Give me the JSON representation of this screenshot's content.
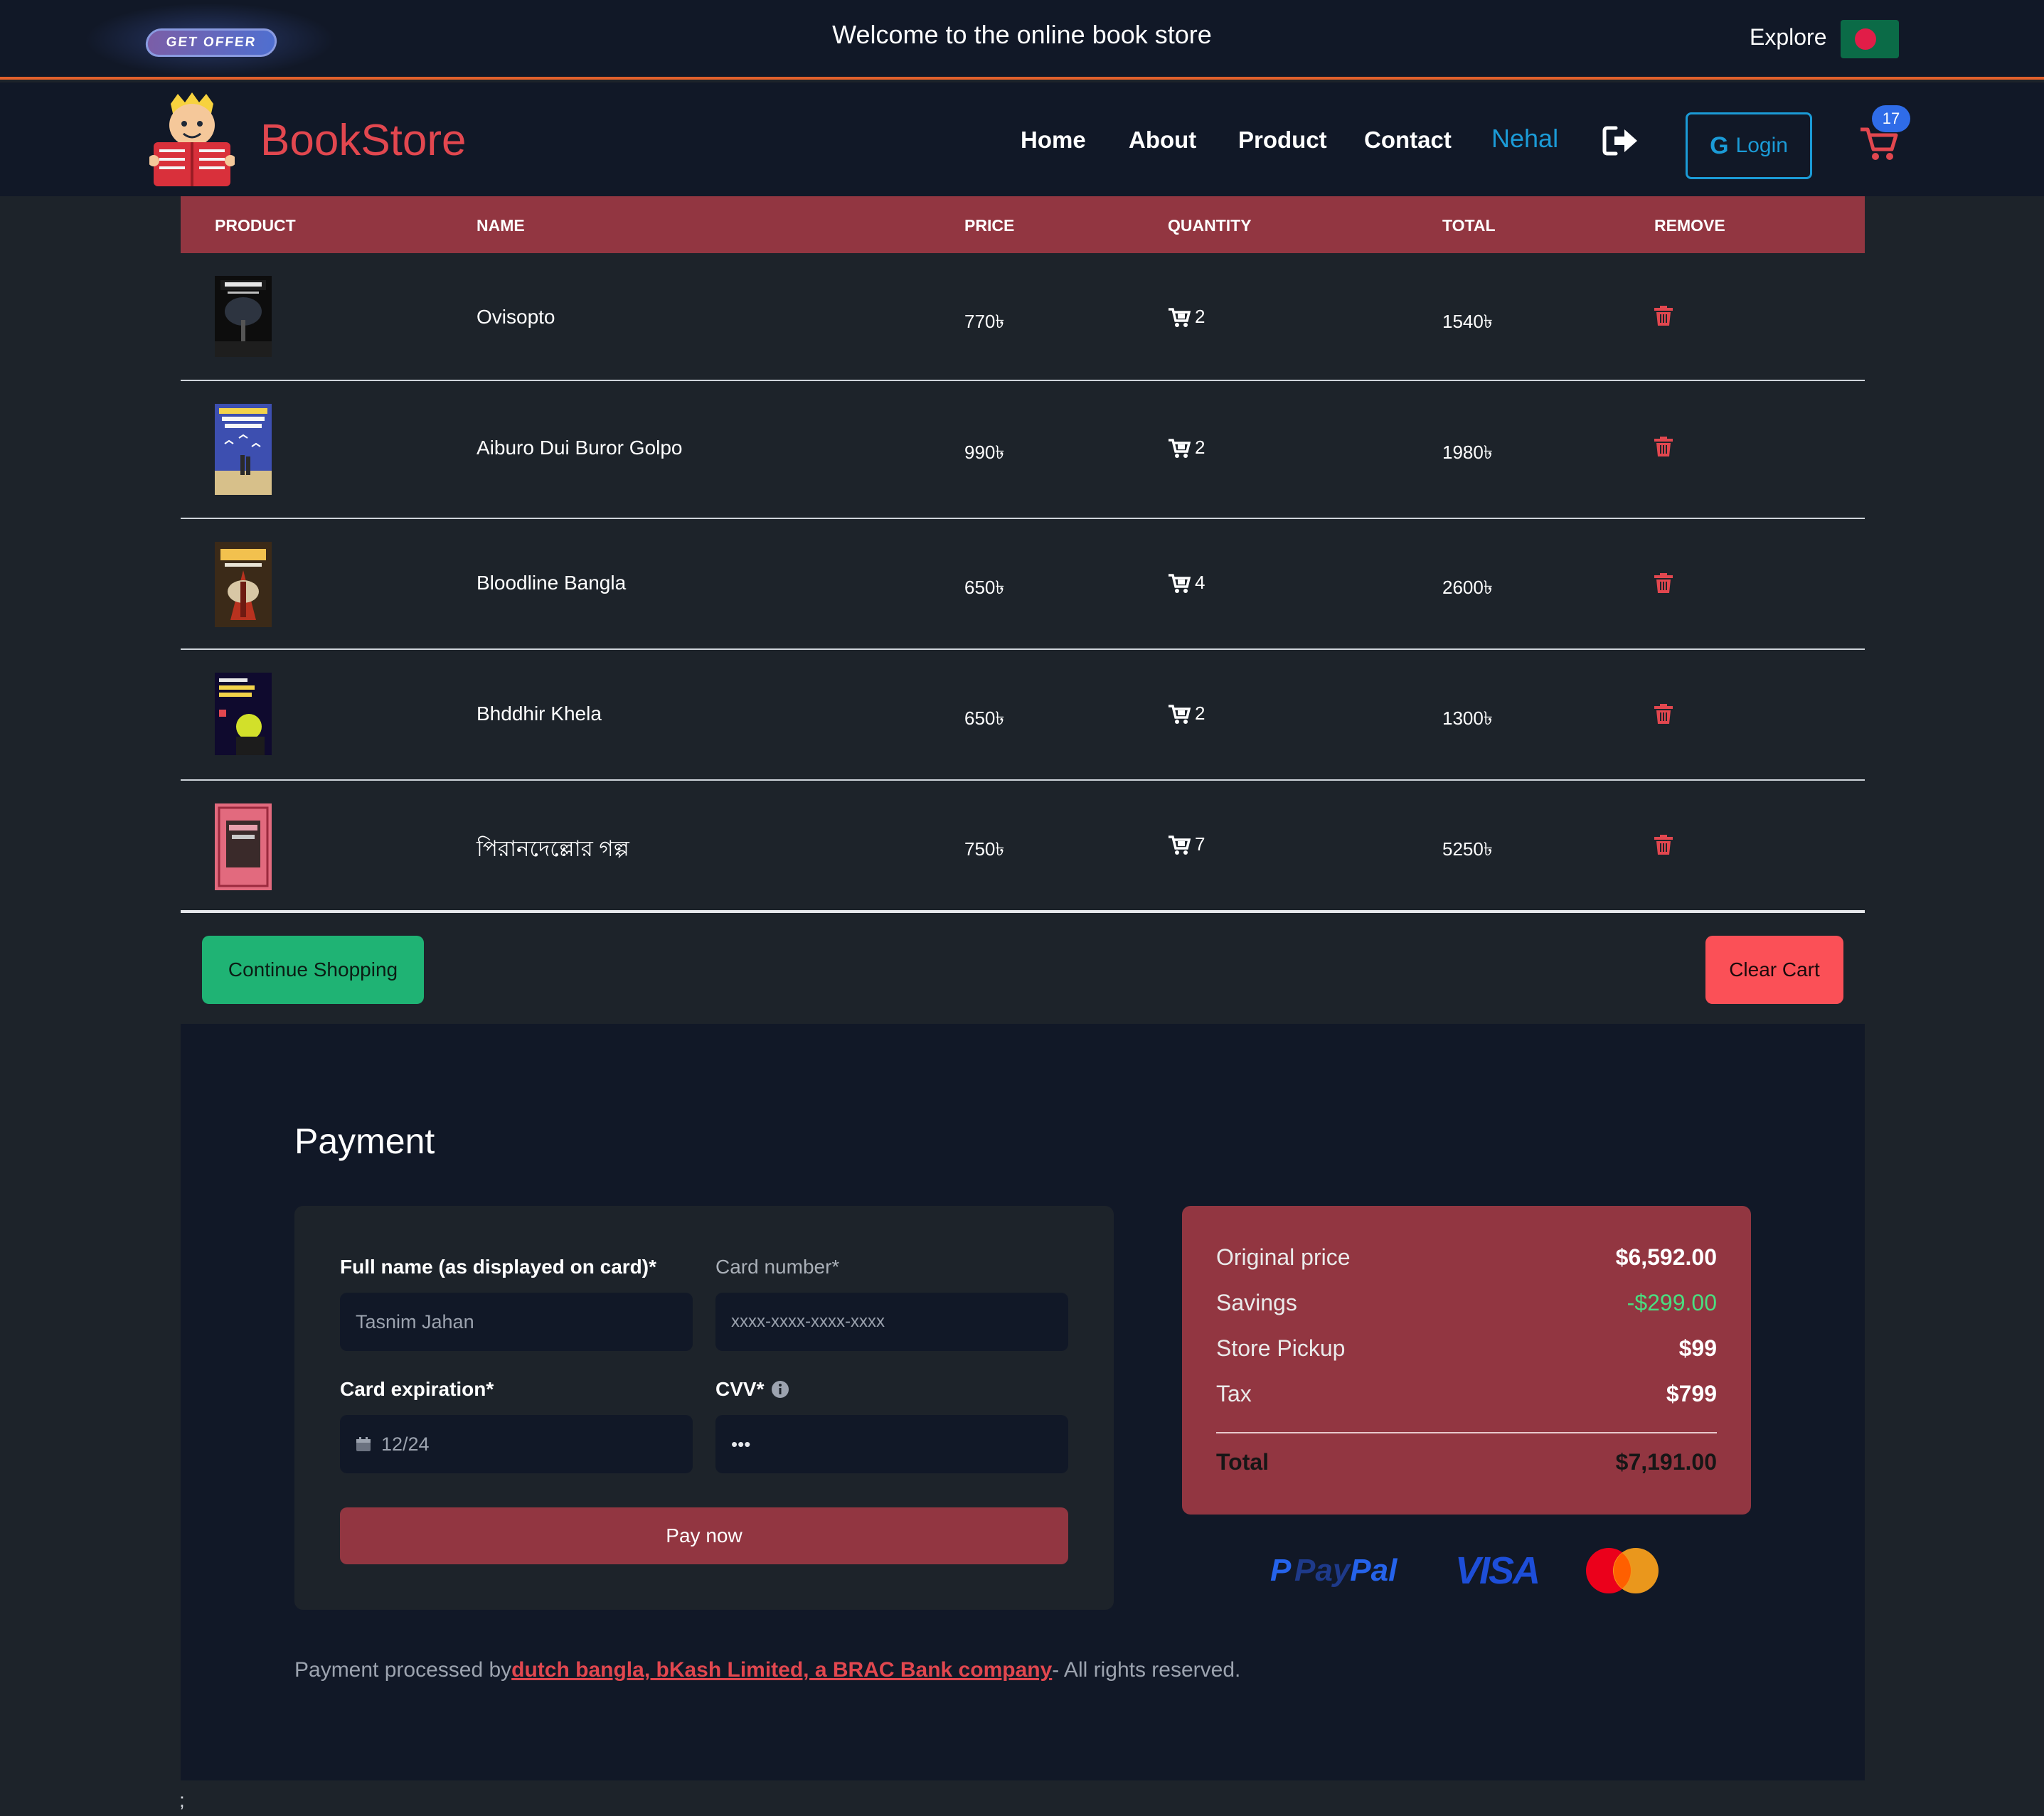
{
  "topbar": {
    "offer_label": "GET OFFER",
    "welcome": "Welcome to the online book store",
    "explore": "Explore"
  },
  "navbar": {
    "brand": "BookStore",
    "links": [
      "Home",
      "About",
      "Product",
      "Contact"
    ],
    "user": "Nehal",
    "login_label": "Login",
    "login_icon_letter": "G",
    "cart_count": "17"
  },
  "cart": {
    "headers": [
      "PRODUCT",
      "NAME",
      "PRICE",
      "QUANTITY",
      "TOTAL",
      "REMOVE"
    ],
    "rows": [
      {
        "name": "Ovisopto",
        "price": "770৳",
        "qty": "2",
        "total": "1540৳"
      },
      {
        "name": "Aiburo Dui Buror Golpo",
        "price": "990৳",
        "qty": "2",
        "total": "1980৳"
      },
      {
        "name": "Bloodline Bangla",
        "price": "650৳",
        "qty": "4",
        "total": "2600৳"
      },
      {
        "name": "Bhddhir Khela",
        "price": "650৳",
        "qty": "2",
        "total": "1300৳"
      },
      {
        "name": "পিরানদেল্লোর গল্প",
        "price": "750৳",
        "qty": "7",
        "total": "5250৳"
      }
    ],
    "continue_label": "Continue Shopping",
    "clear_label": "Clear Cart"
  },
  "payment": {
    "title": "Payment",
    "full_name_label": "Full name (as displayed on card)*",
    "full_name_value": "Tasnim Jahan",
    "card_number_label": "Card number*",
    "card_number_placeholder": "xxxx-xxxx-xxxx-xxxx",
    "expiration_label": "Card expiration*",
    "expiration_value": "12/24",
    "cvv_label": "CVV*",
    "cvv_value": "•••",
    "pay_label": "Pay now"
  },
  "summary": {
    "original_label": "Original price",
    "original_value": "$6,592.00",
    "savings_label": "Savings",
    "savings_value": "-$299.00",
    "pickup_label": "Store Pickup",
    "pickup_value": "$99",
    "tax_label": "Tax",
    "tax_value": "$799",
    "total_label": "Total",
    "total_value": "$7,191.00"
  },
  "payment_brands": {
    "paypal_a": "Pay",
    "paypal_b": "Pal",
    "visa": "VISA"
  },
  "footer": {
    "prefix": "Payment processed by",
    "link": "dutch bangla, bKash Limited, a BRAC Bank company",
    "suffix": "- All rights reserved."
  },
  "stray_text": ";",
  "colors": {
    "accent_red": "#923641",
    "brand_red": "#e2474f",
    "link_blue": "#1b9bd7",
    "continue_green": "#1fb374",
    "clear_red": "#fb5057",
    "savings_green": "#4ade80",
    "background": "#1d232a",
    "panel": "#111827"
  },
  "icons": [
    "flag-icon",
    "book-mascot-icon",
    "logout-icon",
    "google-icon",
    "cart-icon",
    "trash-icon",
    "calendar-icon",
    "info-icon",
    "mastercard-icon"
  ]
}
